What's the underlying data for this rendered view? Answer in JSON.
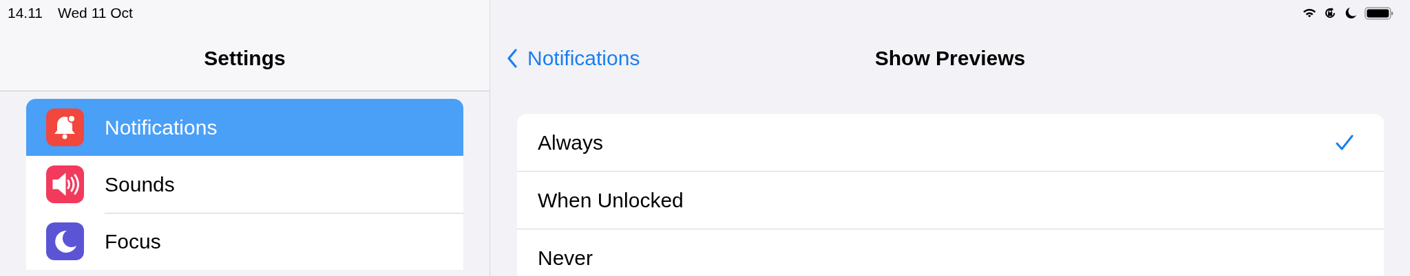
{
  "status_bar": {
    "time": "14.11",
    "date": "Wed 11 Oct"
  },
  "sidebar": {
    "title": "Settings",
    "items": [
      {
        "label": "Notifications",
        "kind": "bell",
        "color": "#f2473c",
        "selected": true
      },
      {
        "label": "Sounds",
        "kind": "speaker",
        "color": "#f23a5d",
        "selected": false
      },
      {
        "label": "Focus",
        "kind": "moon",
        "color": "#5b55d6",
        "selected": false
      }
    ]
  },
  "detail": {
    "back": "Notifications",
    "title": "Show Previews",
    "options": [
      {
        "label": "Always",
        "selected": true
      },
      {
        "label": "When Unlocked",
        "selected": false
      },
      {
        "label": "Never",
        "selected": false
      }
    ]
  }
}
